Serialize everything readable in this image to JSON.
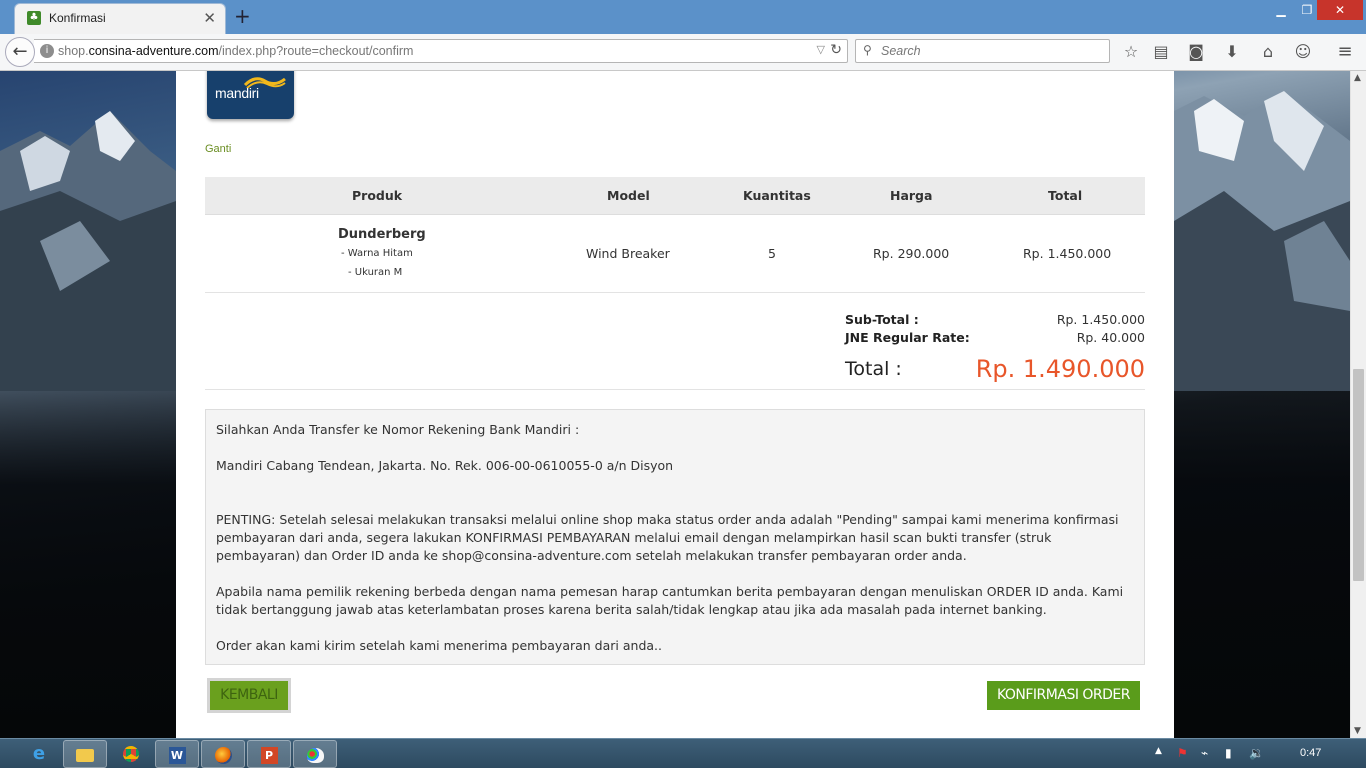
{
  "browser": {
    "tab_title": "Konfirmasi",
    "tab_close": "✕",
    "new_tab": "+",
    "url_prefix": "shop.",
    "url_domain": "consina-adventure.com",
    "url_path": "/index.php?route=checkout/confirm",
    "search_placeholder": "Search"
  },
  "page": {
    "bank_logo_text": "mandiri",
    "change_link": "Ganti",
    "table": {
      "headers": [
        "Produk",
        "Model",
        "Kuantitas",
        "Harga",
        "Total"
      ],
      "rows": [
        {
          "product": "Dunderberg",
          "options": [
            "- Warna Hitam",
            "- Ukuran M"
          ],
          "model": "Wind Breaker",
          "quantity": "5",
          "price": "Rp. 290.000",
          "total": "Rp. 1.450.000"
        }
      ]
    },
    "totals": {
      "subtotal_label": "Sub-Total :",
      "subtotal_value": "Rp. 1.450.000",
      "shipping_label": "JNE Regular Rate:",
      "shipping_value": "Rp. 40.000",
      "grand_label": "Total :",
      "grand_value": "Rp. 1.490.000"
    },
    "info": {
      "line1": "Silahkan Anda Transfer ke Nomor Rekening Bank Mandiri :",
      "line2": "Mandiri Cabang Tendean, Jakarta. No. Rek. 006-00-0610055-0 a/n Disyon",
      "para1": "PENTING: Setelah selesai melakukan transaksi melalui online shop maka status order anda adalah \"Pending\" sampai kami menerima konfirmasi pembayaran dari anda, segera lakukan KONFIRMASI PEMBAYARAN melalui email dengan melampirkan hasil scan bukti transfer (struk pembayaran) dan Order ID anda ke shop@consina-adventure.com setelah melakukan transfer pembayaran order anda.",
      "para2": "Apabila nama pemilik rekening berbeda dengan nama pemesan harap cantumkan berita pembayaran dengan menuliskan ORDER ID anda. Kami tidak bertanggung jawab atas keterlambatan proses karena berita salah/tidak lengkap atau jika ada masalah pada internet banking.",
      "para3": "Order akan kami kirim setelah kami menerima pembayaran dari anda.."
    },
    "back_button": "KEMBALI",
    "confirm_button": "KONFIRMASI ORDER"
  },
  "taskbar": {
    "apps": [
      "internet-explorer",
      "file-explorer",
      "chrome",
      "word",
      "firefox",
      "powerpoint",
      "paint"
    ],
    "clock": "0:47"
  },
  "colors": {
    "accent_green": "#5a9c1b",
    "total_orange": "#e8562a",
    "titlebar_blue": "#5b91c9"
  }
}
